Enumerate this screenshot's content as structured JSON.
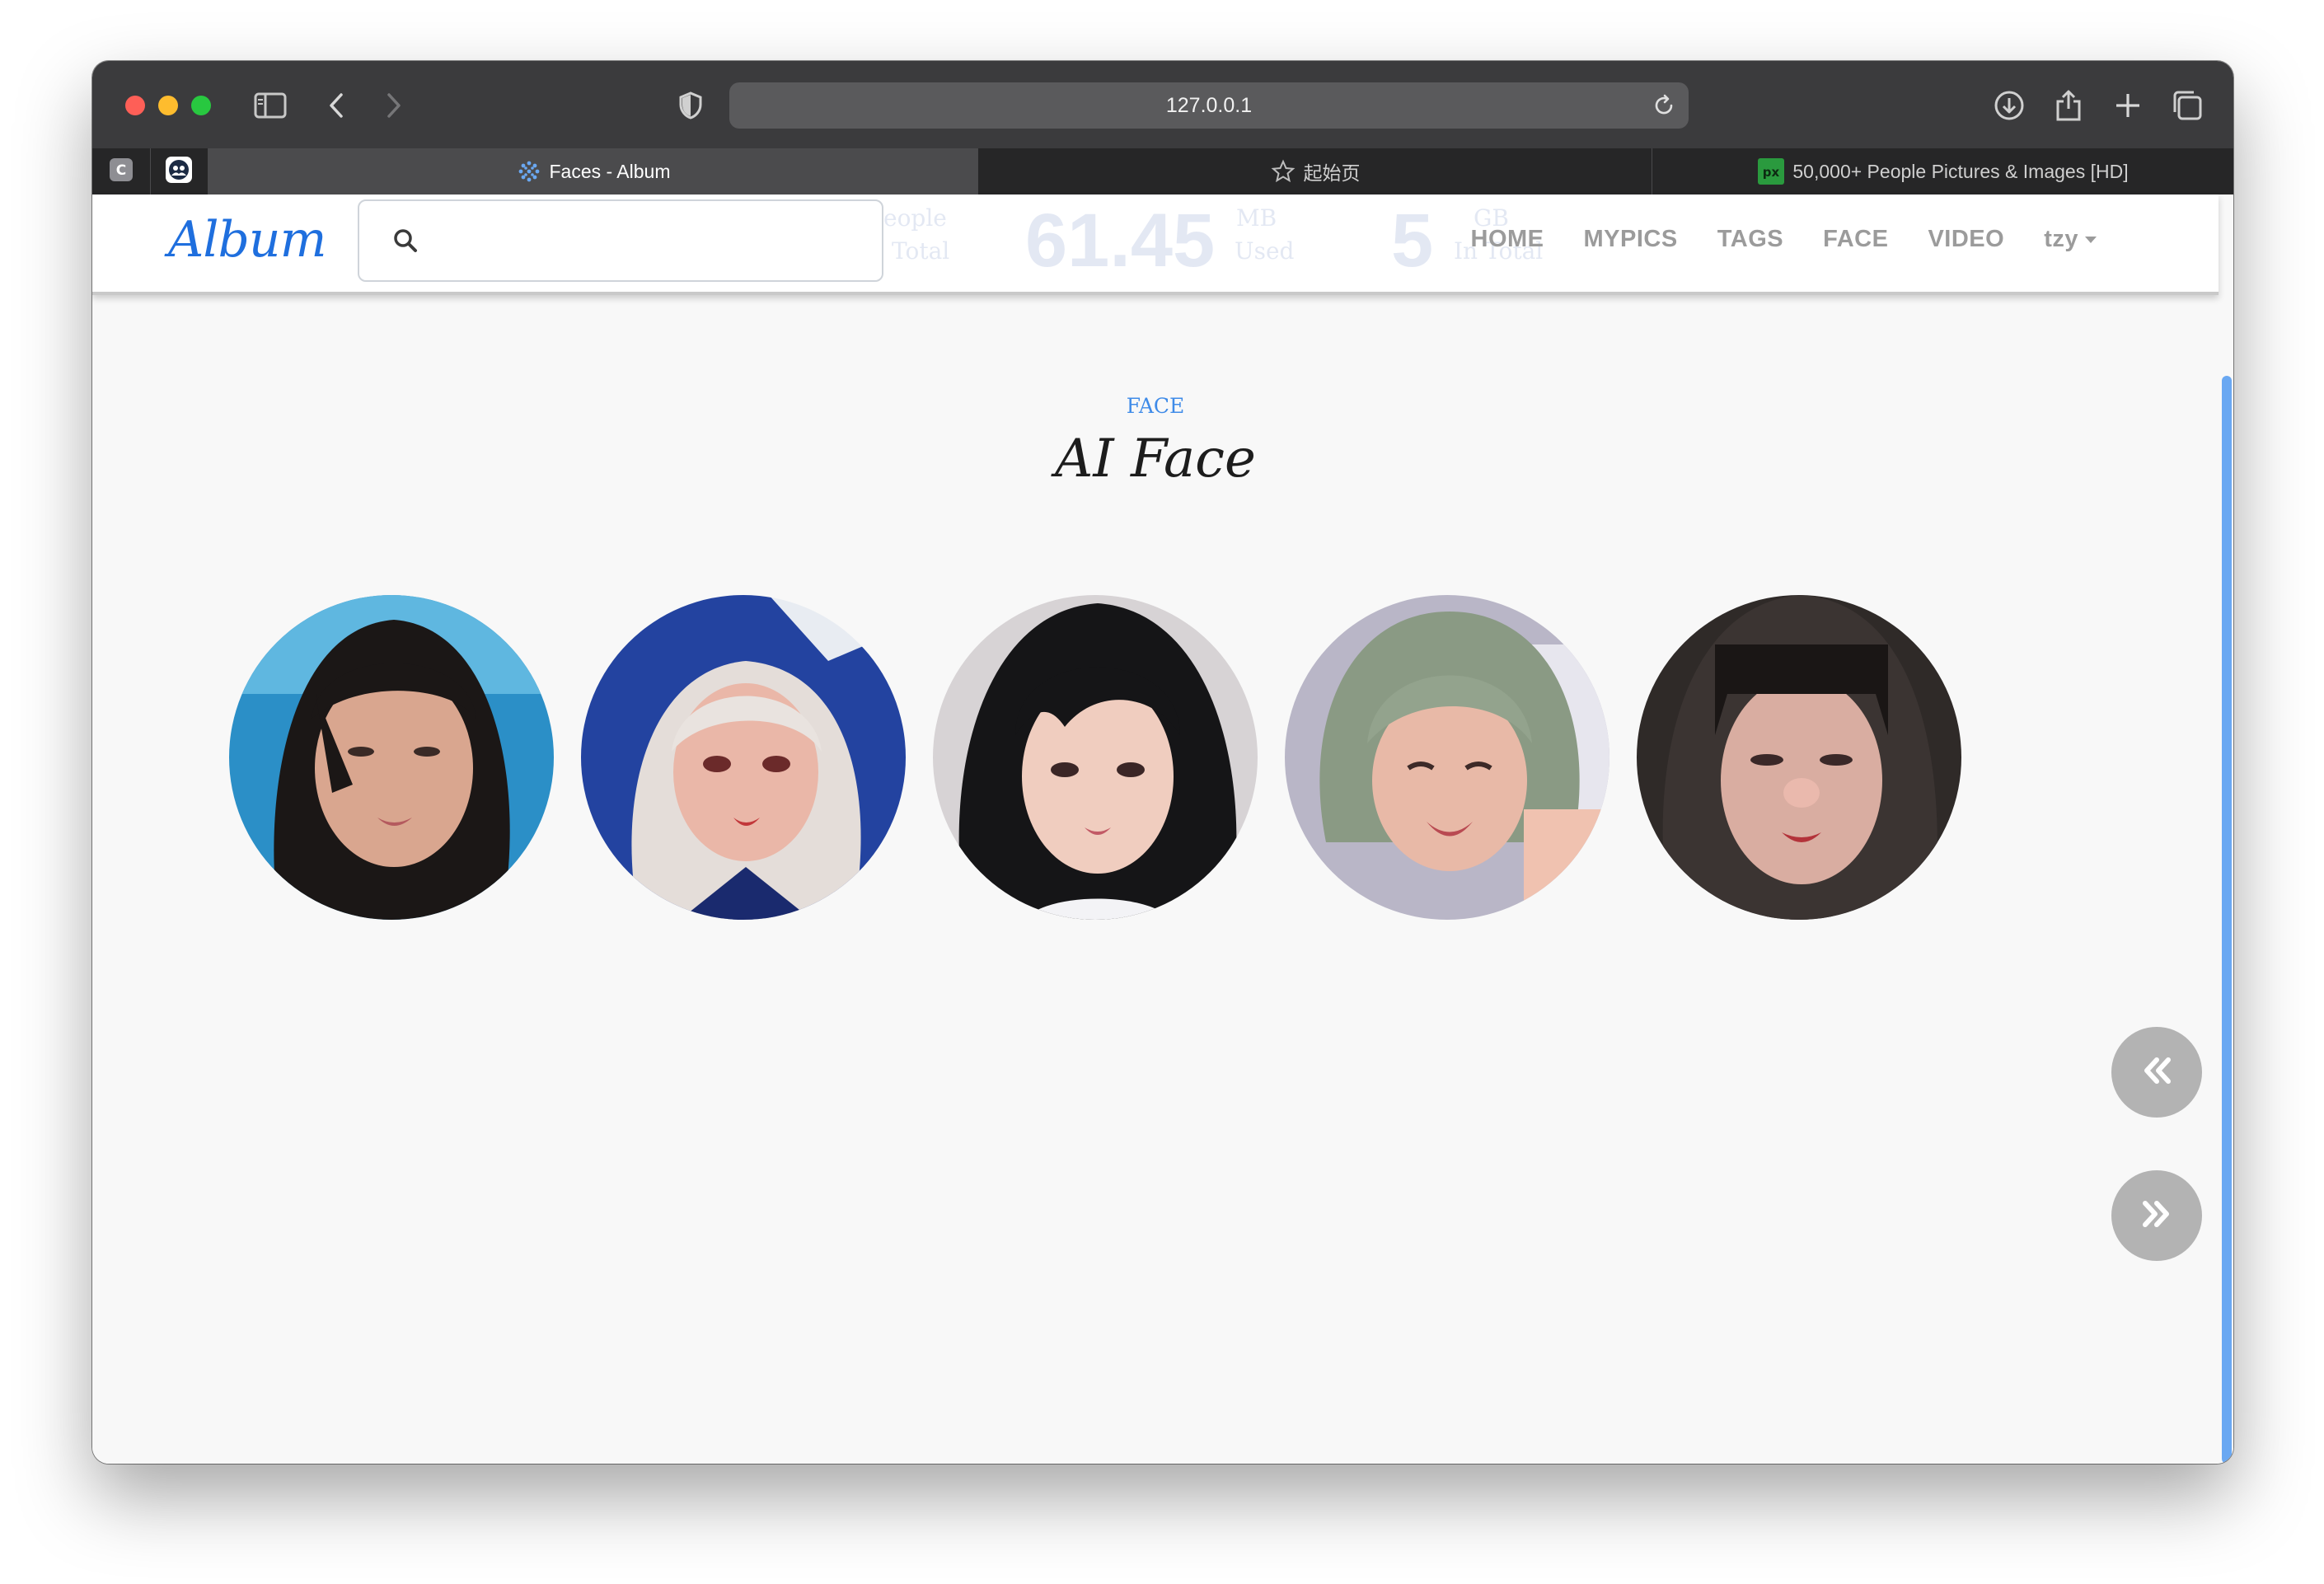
{
  "browser": {
    "url": "127.0.0.1",
    "pinned_tabs": [
      {
        "icon": "c-app-icon"
      },
      {
        "icon": "people-app-icon"
      }
    ],
    "tabs": [
      {
        "title": "Faces - Album",
        "icon": "album-favicon",
        "active": true
      },
      {
        "title": "起始页",
        "icon": "star-icon",
        "active": false
      },
      {
        "title": "50,000+ People Pictures & Images [HD]",
        "icon": "px-favicon",
        "active": false
      }
    ]
  },
  "navbar": {
    "brand": "Album",
    "search_placeholder": "",
    "links": [
      "HOME",
      "MYPICS",
      "TAGS",
      "FACE",
      "VIDEO"
    ],
    "user": "tzy",
    "ghost": {
      "people_label_1": "eople",
      "people_label_2": "Total",
      "size_value": "61.45",
      "size_label_1": "MB",
      "size_label_2": "Used",
      "count_value": "5",
      "count_label_1": "GB",
      "count_label_2": "In Total"
    }
  },
  "main": {
    "section_label": "FACE",
    "title": "AI Face",
    "faces": [
      {
        "name": "face-1"
      },
      {
        "name": "face-2"
      },
      {
        "name": "face-3"
      },
      {
        "name": "face-4"
      },
      {
        "name": "face-5"
      }
    ]
  },
  "controls": {
    "prev_icon": "double-chevron-left-icon",
    "next_icon": "double-chevron-right-icon"
  },
  "colors": {
    "brand": "#1f6fde",
    "accent": "#3f8be8",
    "nav_text": "#9b9b9b",
    "float_button": "#b3b3b3"
  }
}
